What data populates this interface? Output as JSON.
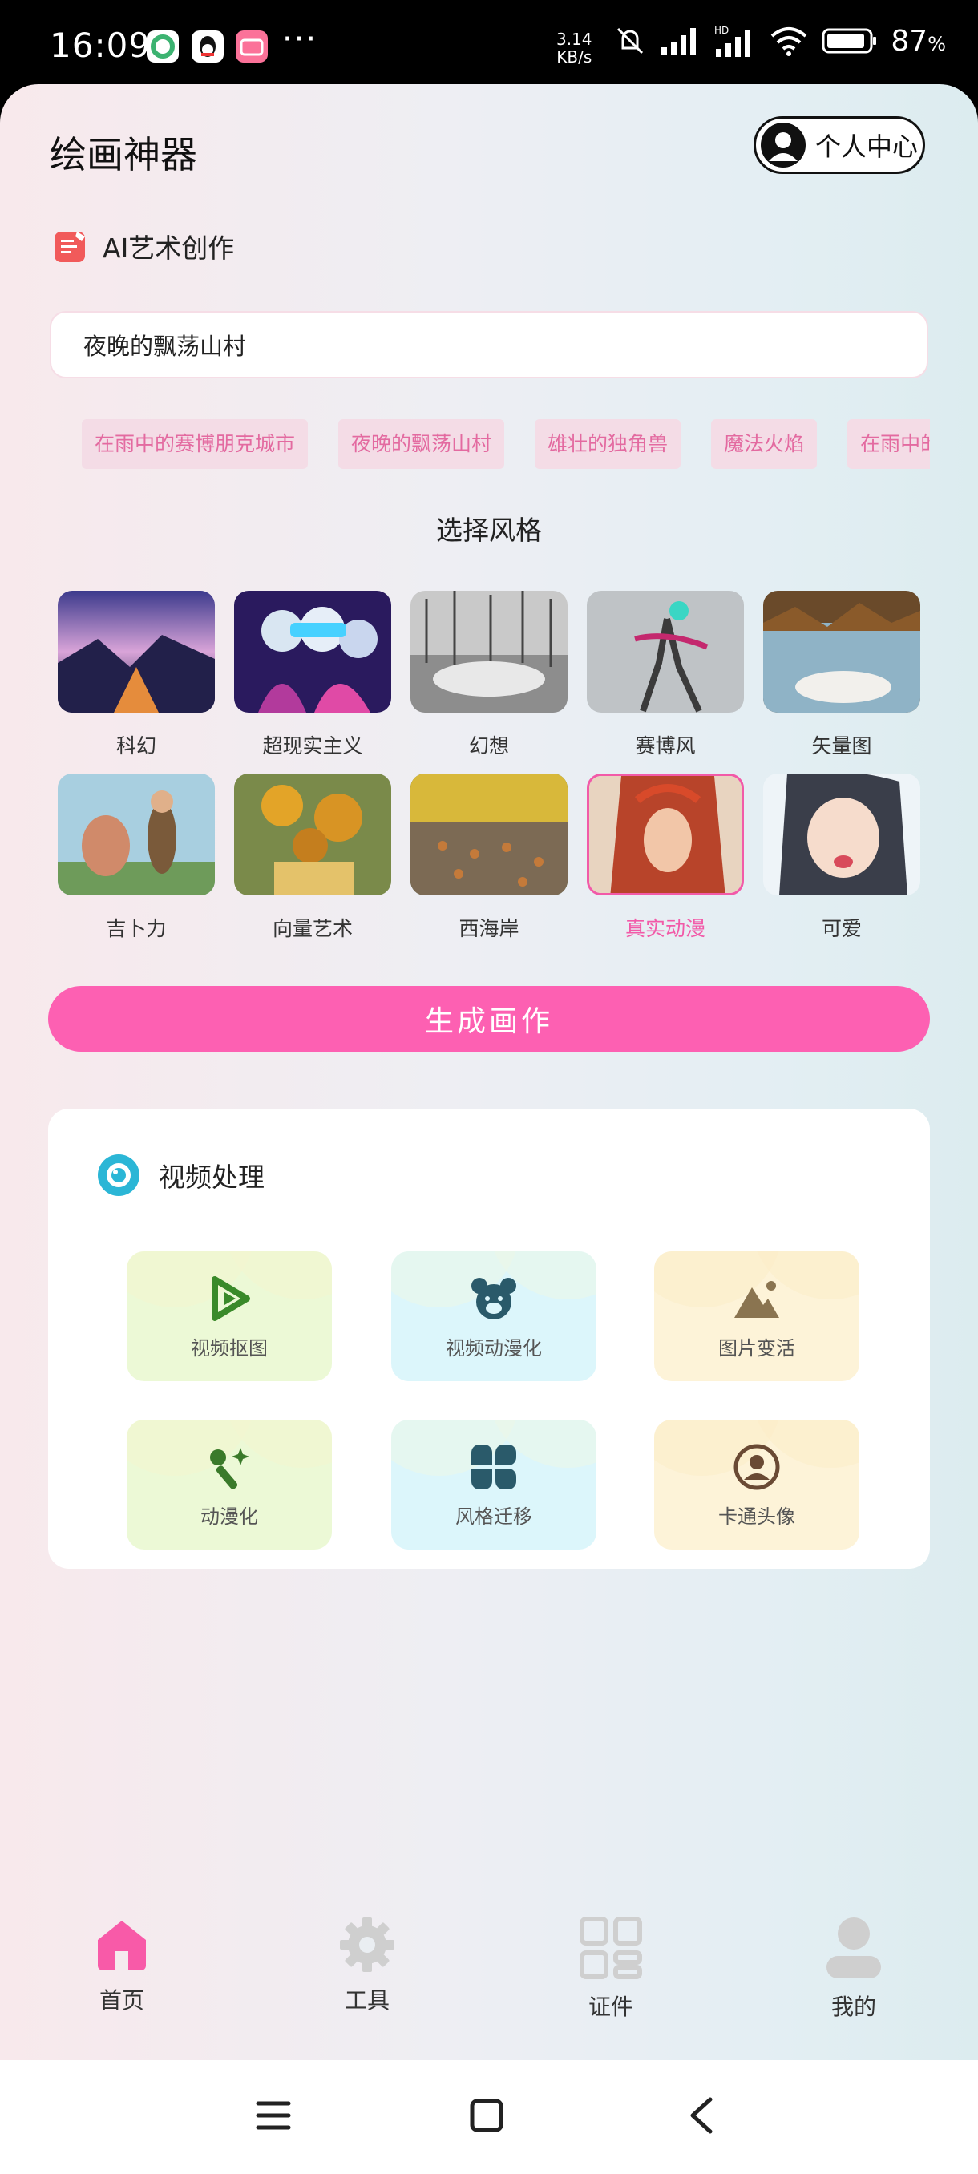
{
  "status_bar": {
    "time": "16:09",
    "speed_value": "3.14",
    "speed_unit": "KB/s",
    "battery": "87",
    "battery_unit": "%"
  },
  "header": {
    "title": "绘画神器",
    "profile_label": "个人中心"
  },
  "ai_section": {
    "label": "AI艺术创作"
  },
  "prompt": {
    "value": "夜晚的飘荡山村"
  },
  "chips": [
    "在雨中的赛博朋克城市",
    "夜晚的飘荡山村",
    "雄壮的独角兽",
    "魔法火焰",
    "在雨中的赛博朋克城市"
  ],
  "styles": {
    "title": "选择风格",
    "items": [
      {
        "label": "科幻"
      },
      {
        "label": "超现实主义"
      },
      {
        "label": "幻想"
      },
      {
        "label": "赛博风"
      },
      {
        "label": "矢量图"
      },
      {
        "label": "吉卜力"
      },
      {
        "label": "向量艺术"
      },
      {
        "label": "西海岸"
      },
      {
        "label": "真实动漫"
      },
      {
        "label": "可爱"
      }
    ],
    "selected_index": 8
  },
  "generate_button": "生成画作",
  "video_section": {
    "title": "视频处理",
    "tools": [
      {
        "label": "视频抠图",
        "icon": "play-logo-icon"
      },
      {
        "label": "视频动漫化",
        "icon": "bear-icon"
      },
      {
        "label": "图片变活",
        "icon": "mountain-image-icon"
      },
      {
        "label": "动漫化",
        "icon": "magic-wand-icon"
      },
      {
        "label": "风格迁移",
        "icon": "four-leaf-icon"
      },
      {
        "label": "卡通头像",
        "icon": "avatar-icon"
      }
    ]
  },
  "tabs": [
    {
      "label": "首页",
      "icon": "home-icon",
      "active": true
    },
    {
      "label": "工具",
      "icon": "gear-icon",
      "active": false
    },
    {
      "label": "证件",
      "icon": "grid-icon",
      "active": false
    },
    {
      "label": "我的",
      "icon": "person-icon",
      "active": false
    }
  ],
  "colors": {
    "accent": "#fd60b2",
    "chip_bg": "#f4dce6",
    "chip_text": "#e36aa0",
    "tab_active": "#f85aa8",
    "tab_inactive": "#cfcfcf"
  }
}
